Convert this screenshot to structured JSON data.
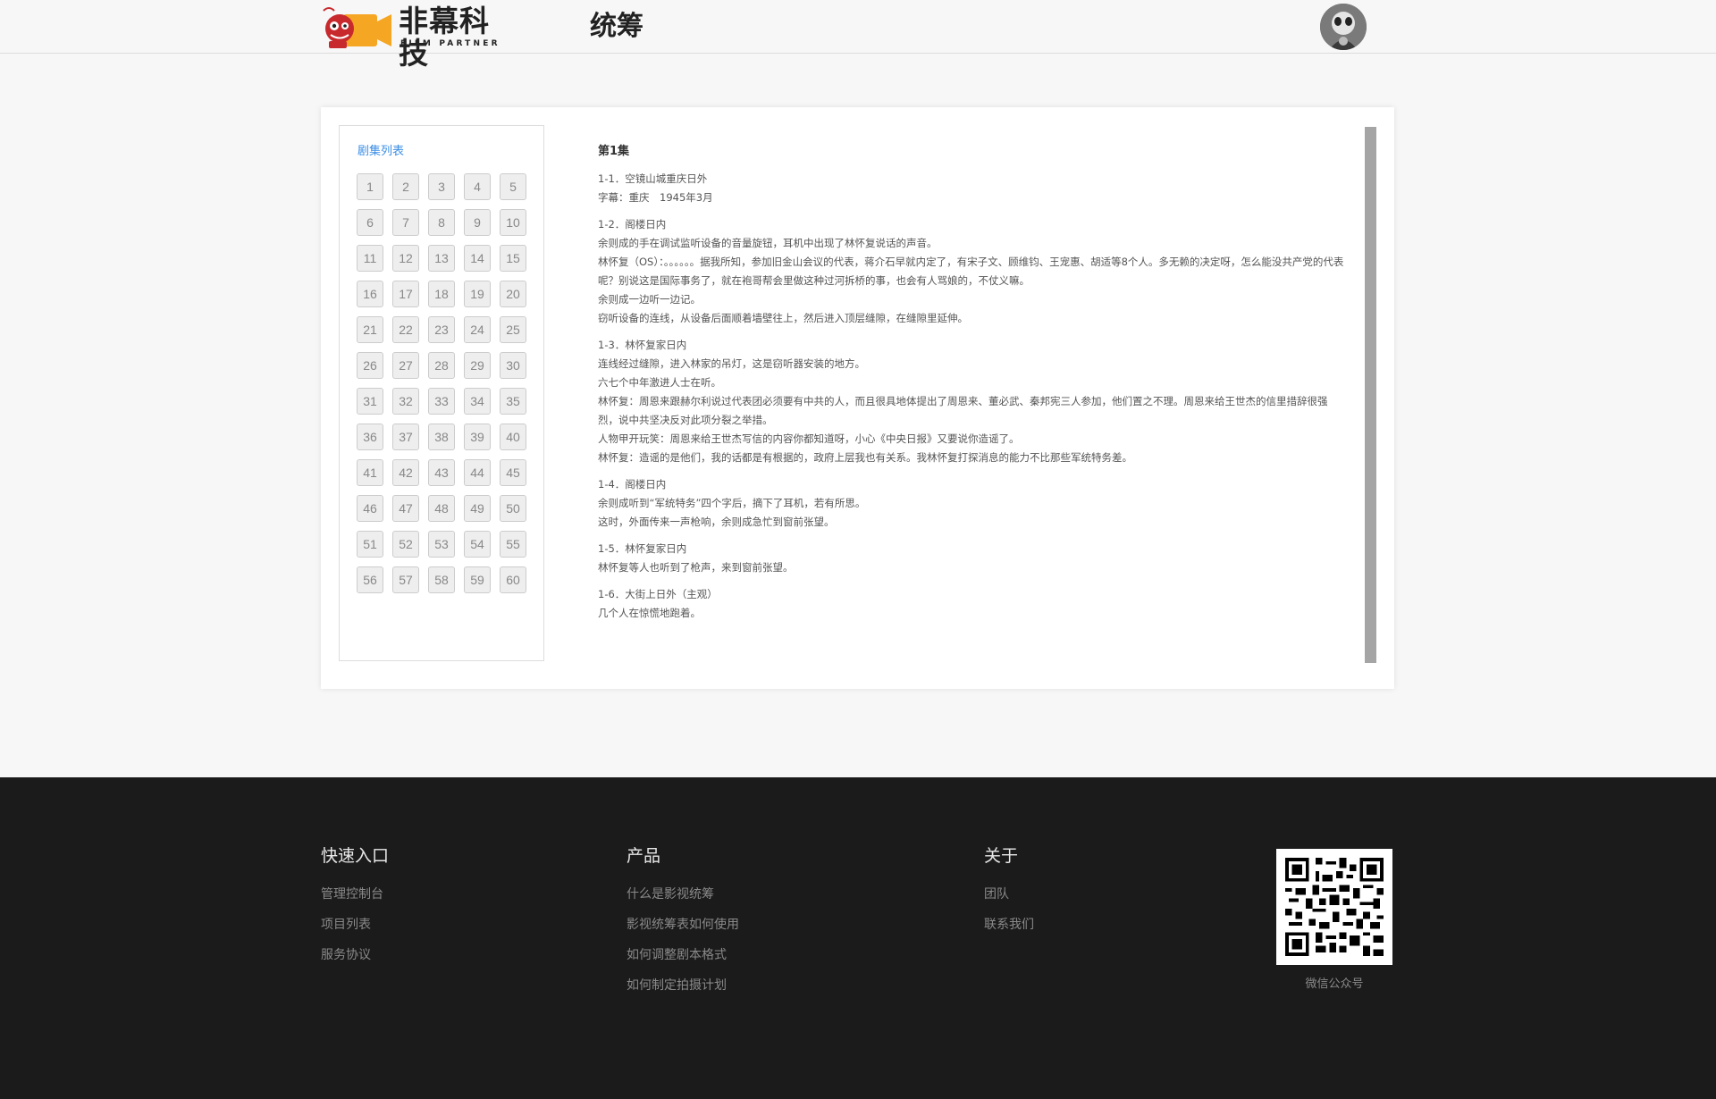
{
  "header": {
    "logo_cn": "非幕科技",
    "logo_en": "FILM PARTNER",
    "page_title": "统筹"
  },
  "episodes": {
    "title": "剧集列表",
    "items": [
      "1",
      "2",
      "3",
      "4",
      "5",
      "6",
      "7",
      "8",
      "9",
      "10",
      "11",
      "12",
      "13",
      "14",
      "15",
      "16",
      "17",
      "18",
      "19",
      "20",
      "21",
      "22",
      "23",
      "24",
      "25",
      "26",
      "27",
      "28",
      "29",
      "30",
      "31",
      "32",
      "33",
      "34",
      "35",
      "36",
      "37",
      "38",
      "39",
      "40",
      "41",
      "42",
      "43",
      "44",
      "45",
      "46",
      "47",
      "48",
      "49",
      "50",
      "51",
      "52",
      "53",
      "54",
      "55",
      "56",
      "57",
      "58",
      "59",
      "60"
    ]
  },
  "script": {
    "title": "第1集",
    "scenes": [
      {
        "lines": [
          "1-1．空镜山城重庆日外",
          "字幕：重庆　1945年3月"
        ]
      },
      {
        "lines": [
          "1-2．阁楼日内",
          "余则成的手在调试监听设备的音量旋钮，耳机中出现了林怀复说话的声音。",
          "林怀复（OS）：。。。。。。据我所知，参加旧金山会议的代表，蒋介石早就内定了，有宋子文、顾维钧、王宠惠、胡适等8个人。多无赖的决定呀，怎么能没共产党的代表呢？别说这是国际事务了，就在袍哥帮会里做这种过河拆桥的事，也会有人骂娘的，不仗义嘛。",
          "余则成一边听一边记。",
          "窃听设备的连线，从设备后面顺着墙壁往上，然后进入顶层缝隙，在缝隙里延伸。"
        ]
      },
      {
        "lines": [
          "1-3．林怀复家日内",
          "连线经过缝隙，进入林家的吊灯，这是窃听器安装的地方。",
          "六七个中年激进人士在听。",
          "林怀复：周恩来跟赫尔利说过代表团必须要有中共的人，而且很具地体提出了周恩来、董必武、秦邦宪三人参加，他们置之不理。周恩来给王世杰的信里措辞很强烈，说中共坚决反对此项分裂之举措。",
          "人物甲开玩笑：周恩来给王世杰写信的内容你都知道呀，小心《中央日报》又要说你造谣了。",
          "林怀复：造谣的是他们，我的话都是有根据的，政府上层我也有关系。我林怀复打探消息的能力不比那些军统特务差。"
        ]
      },
      {
        "lines": [
          "1-4．阁楼日内",
          "余则成听到“军统特务”四个字后，摘下了耳机，若有所思。",
          "这时，外面传来一声枪响，余则成急忙到窗前张望。"
        ]
      },
      {
        "lines": [
          "1-5．林怀复家日内",
          "林怀复等人也听到了枪声，来到窗前张望。"
        ]
      },
      {
        "lines": [
          "1-6．大街上日外（主观）",
          "几个人在惊慌地跑着。"
        ]
      }
    ]
  },
  "footer": {
    "quick": {
      "title": "快速入口",
      "links": [
        "管理控制台",
        "项目列表",
        "服务协议"
      ]
    },
    "product": {
      "title": "产品",
      "links": [
        "什么是影视统筹",
        "影视统筹表如何使用",
        "如何调整剧本格式",
        "如何制定拍摄计划"
      ]
    },
    "about": {
      "title": "关于",
      "links": [
        "团队",
        "联系我们"
      ]
    },
    "qr_caption": "微信公众号"
  },
  "colors": {
    "accent": "#3a8ee6",
    "logo_orange": "#f5a623",
    "logo_red": "#c8292d",
    "footer_bg": "#1b1b1b"
  }
}
